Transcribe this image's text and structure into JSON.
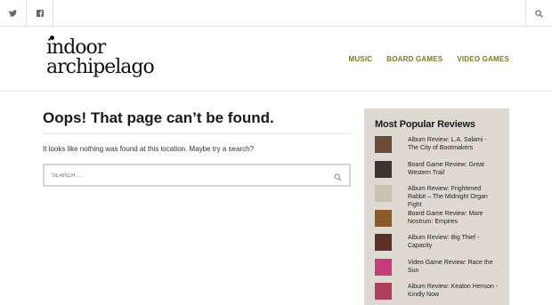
{
  "topbar": {
    "icons": [
      "twitter-icon",
      "facebook-icon",
      "search-icon"
    ]
  },
  "site": {
    "logo_line1": "indoor",
    "logo_line2": "archipelago"
  },
  "nav": {
    "items": [
      "MUSIC",
      "BOARD GAMES",
      "VIDEO GAMES"
    ]
  },
  "main": {
    "title": "Oops! That page can’t be found.",
    "message": "It looks like nothing was found at this location. Maybe try a search?",
    "search_placeholder": "SEARCH ..."
  },
  "sidebar": {
    "heading": "Most Popular Reviews",
    "reviews": [
      {
        "title": "Album Review: L.A. Salami - The City of Bootmakers",
        "thumb_color": "#6b4a3a"
      },
      {
        "title": "Board Game Review: Great Western Trail",
        "thumb_color": "#3a3430"
      },
      {
        "title": "Album Review: Frightened Rabbit – The Midnight Organ Fight",
        "thumb_color": "#c9c3b4"
      },
      {
        "title": "Board Game Review: Mare Nostrum: Empires",
        "thumb_color": "#8a5a2a"
      },
      {
        "title": "Album Review: Big Thief - Capacity",
        "thumb_color": "#5a3028"
      },
      {
        "title": "Video Game Review: Race the Sun",
        "thumb_color": "#c83a7a"
      },
      {
        "title": "Album Review: Keaton Henson - Kindly Now",
        "thumb_color": "#b0405a"
      }
    ]
  }
}
